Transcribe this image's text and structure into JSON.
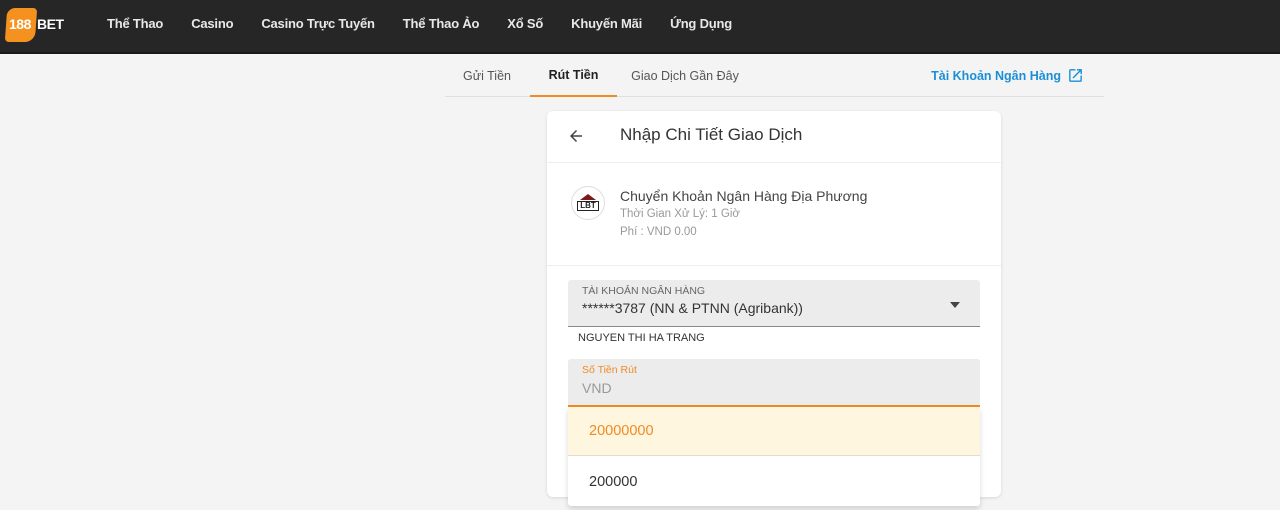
{
  "header": {
    "logo_num": "188",
    "logo_bet": "BET",
    "nav": [
      "Thể Thao",
      "Casino",
      "Casino Trực Tuyến",
      "Thể Thao Ảo",
      "Xổ Số",
      "Khuyến Mãi",
      "Ứng Dụng"
    ]
  },
  "tabs": {
    "deposit": "Gửi Tiền",
    "withdraw": "Rút Tiền",
    "history": "Giao Dịch Gần Đây",
    "bank_account_link": "Tài Khoản Ngân Hàng"
  },
  "card": {
    "title": "Nhập Chi Tiết Giao Dịch",
    "method": {
      "logo_text": "LBT",
      "name": "Chuyển Khoản Ngân Hàng Địa Phương",
      "processing_time": "Thời Gian Xử Lý: 1 Giờ",
      "fee": "Phí : VND 0.00"
    },
    "bank_field": {
      "label": "TÀI KHOẢN NGÂN HÀNG",
      "value": "******3787 (NN & PTNN (Agribank))",
      "holder": "NGUYEN THI HA TRANG"
    },
    "amount_field": {
      "label": "Số Tiền Rút",
      "placeholder": "VND"
    }
  },
  "suggestions": [
    "20000000",
    "200000"
  ],
  "colors": {
    "accent": "#f08a24",
    "link": "#1a8fd8",
    "topbar": "#262626"
  }
}
